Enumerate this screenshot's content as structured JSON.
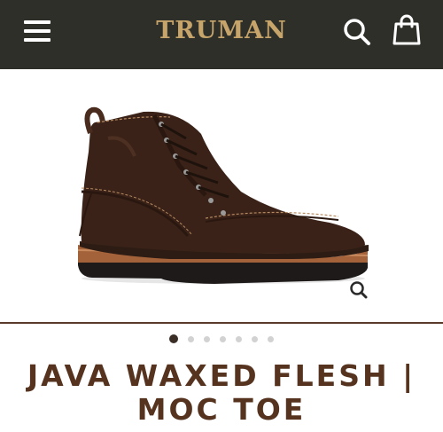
{
  "header": {
    "brand": "TRUMAN",
    "menu_icon": "hamburger-menu-icon",
    "search_icon": "search-icon",
    "cart_icon": "shopping-bag-icon"
  },
  "gallery": {
    "image": "boot-product-photo",
    "zoom_icon": "zoom-icon",
    "slide_count": 7,
    "active_slide": 1
  },
  "product": {
    "title_line1": "JAVA WAXED FLESH |",
    "title_line2": "MOC TOE"
  },
  "colors": {
    "header_bg": "#2f2f2a",
    "brand_gold": "#c6a46a",
    "title_brown": "#55331f",
    "divider": "#5a3a2a"
  }
}
